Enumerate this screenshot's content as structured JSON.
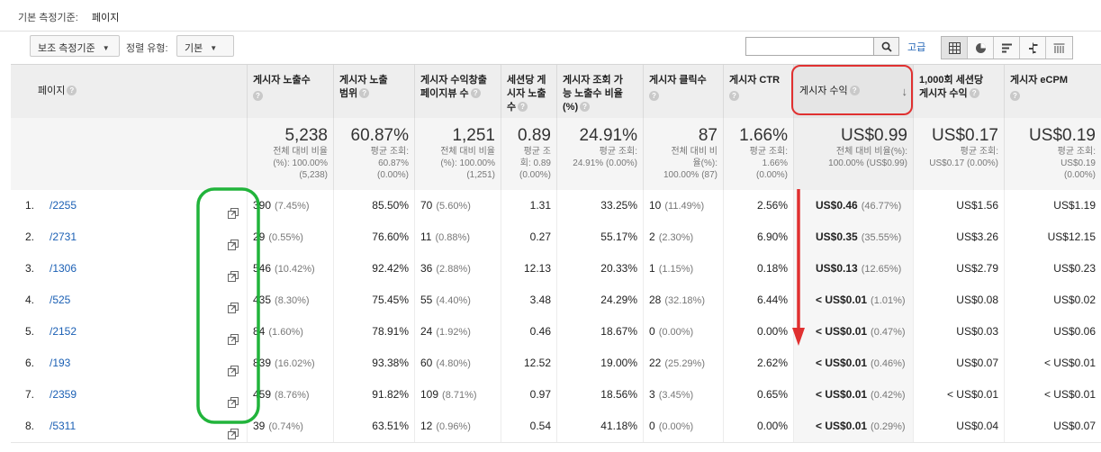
{
  "dimension_bar": {
    "label": "기본 측정기준:",
    "value": "페이지"
  },
  "toolbar": {
    "secondary_dimension": "보조 측정기준",
    "sort_type_label": "정렬 유형:",
    "sort_type_value": "기본",
    "search_placeholder": "",
    "advanced": "고급"
  },
  "columns": [
    "페이지",
    "게시자 노출수",
    "게시자 노출 범위",
    "게시자 수익창출 페이지뷰 수",
    "세션당 게시자 노출 수",
    "게시자 조회 가능 노출수 비율 (%)",
    "게시자 클릭수",
    "게시자 CTR",
    "게시자 수익",
    "1,000회 세션당 게시자 수익",
    "게시자 eCPM"
  ],
  "header_lines": [
    [
      "페이지"
    ],
    [
      "게시자 노출수"
    ],
    [
      "게시자 노출",
      "범위"
    ],
    [
      "게시자 수익창출",
      "페이지뷰 수"
    ],
    [
      "세션당 게",
      "시자 노출",
      "수"
    ],
    [
      "게시자 조회 가",
      "능 노출수 비율",
      "(%)"
    ],
    [
      "게시자 클릭수"
    ],
    [
      "게시자 CTR"
    ],
    [
      "게시자 수익"
    ],
    [
      "1,000회 세션당",
      "게시자 수익"
    ],
    [
      "게시자 eCPM"
    ]
  ],
  "totals": [
    {
      "big": "5,238",
      "sub": [
        "전체 대비 비율",
        "(%): 100.00%",
        "(5,238)"
      ]
    },
    {
      "big": "60.87%",
      "sub": [
        "평균 조회:",
        "60.87%",
        "(0.00%)"
      ]
    },
    {
      "big": "1,251",
      "sub": [
        "전체 대비 비율",
        "(%): 100.00%",
        "(1,251)"
      ]
    },
    {
      "big": "0.89",
      "sub": [
        "평균 조",
        "회: 0.89",
        "(0.00%)"
      ]
    },
    {
      "big": "24.91%",
      "sub": [
        "평균 조회:",
        "24.91% (0.00%)"
      ]
    },
    {
      "big": "87",
      "sub": [
        "전체 대비 비",
        "율(%):",
        "100.00% (87)"
      ]
    },
    {
      "big": "1.66%",
      "sub": [
        "평균 조회:",
        "1.66%",
        "(0.00%)"
      ]
    },
    {
      "big": "US$0.99",
      "sub": [
        "전체 대비 비율(%):",
        "100.00% (US$0.99)"
      ]
    },
    {
      "big": "US$0.17",
      "sub": [
        "평균 조회:",
        "US$0.17 (0.00%)"
      ]
    },
    {
      "big": "US$0.19",
      "sub": [
        "평균 조회:",
        "US$0.19",
        "(0.00%)"
      ]
    }
  ],
  "rows": [
    {
      "n": "1.",
      "page": "/2255",
      "impr": "390",
      "impr_pct": "(7.45%)",
      "cov": "85.50%",
      "pv": "70",
      "pv_pct": "(5.60%)",
      "ips": "1.31",
      "view": "33.25%",
      "clicks": "10",
      "clicks_pct": "(11.49%)",
      "ctr": "2.56%",
      "rev": "US$0.46",
      "rev_pct": "(46.77%)",
      "rps": "US$1.56",
      "ecpm": "US$1.19"
    },
    {
      "n": "2.",
      "page": "/2731",
      "impr": "29",
      "impr_pct": "(0.55%)",
      "cov": "76.60%",
      "pv": "11",
      "pv_pct": "(0.88%)",
      "ips": "0.27",
      "view": "55.17%",
      "clicks": "2",
      "clicks_pct": "(2.30%)",
      "ctr": "6.90%",
      "rev": "US$0.35",
      "rev_pct": "(35.55%)",
      "rps": "US$3.26",
      "ecpm": "US$12.15"
    },
    {
      "n": "3.",
      "page": "/1306",
      "impr": "546",
      "impr_pct": "(10.42%)",
      "cov": "92.42%",
      "pv": "36",
      "pv_pct": "(2.88%)",
      "ips": "12.13",
      "view": "20.33%",
      "clicks": "1",
      "clicks_pct": "(1.15%)",
      "ctr": "0.18%",
      "rev": "US$0.13",
      "rev_pct": "(12.65%)",
      "rps": "US$2.79",
      "ecpm": "US$0.23"
    },
    {
      "n": "4.",
      "page": "/525",
      "impr": "435",
      "impr_pct": "(8.30%)",
      "cov": "75.45%",
      "pv": "55",
      "pv_pct": "(4.40%)",
      "ips": "3.48",
      "view": "24.29%",
      "clicks": "28",
      "clicks_pct": "(32.18%)",
      "ctr": "6.44%",
      "rev": "< US$0.01",
      "rev_pct": "(1.01%)",
      "rps": "US$0.08",
      "ecpm": "US$0.02"
    },
    {
      "n": "5.",
      "page": "/2152",
      "impr": "84",
      "impr_pct": "(1.60%)",
      "cov": "78.91%",
      "pv": "24",
      "pv_pct": "(1.92%)",
      "ips": "0.46",
      "view": "18.67%",
      "clicks": "0",
      "clicks_pct": "(0.00%)",
      "ctr": "0.00%",
      "rev": "< US$0.01",
      "rev_pct": "(0.47%)",
      "rps": "US$0.03",
      "ecpm": "US$0.06"
    },
    {
      "n": "6.",
      "page": "/193",
      "impr": "839",
      "impr_pct": "(16.02%)",
      "cov": "93.38%",
      "pv": "60",
      "pv_pct": "(4.80%)",
      "ips": "12.52",
      "view": "19.00%",
      "clicks": "22",
      "clicks_pct": "(25.29%)",
      "ctr": "2.62%",
      "rev": "< US$0.01",
      "rev_pct": "(0.46%)",
      "rps": "US$0.07",
      "ecpm": "< US$0.01"
    },
    {
      "n": "7.",
      "page": "/2359",
      "impr": "459",
      "impr_pct": "(8.76%)",
      "cov": "91.82%",
      "pv": "109",
      "pv_pct": "(8.71%)",
      "ips": "0.97",
      "view": "18.56%",
      "clicks": "3",
      "clicks_pct": "(3.45%)",
      "ctr": "0.65%",
      "rev": "< US$0.01",
      "rev_pct": "(0.42%)",
      "rps": "< US$0.01",
      "ecpm": "< US$0.01"
    },
    {
      "n": "8.",
      "page": "/5311",
      "impr": "39",
      "impr_pct": "(0.74%)",
      "cov": "63.51%",
      "pv": "12",
      "pv_pct": "(0.96%)",
      "ips": "0.54",
      "view": "41.18%",
      "clicks": "0",
      "clicks_pct": "(0.00%)",
      "ctr": "0.00%",
      "rev": "< US$0.01",
      "rev_pct": "(0.29%)",
      "rps": "US$0.04",
      "ecpm": "US$0.07"
    }
  ],
  "colors": {
    "link": "#1a5fb4",
    "highlight_red": "#e03030",
    "highlight_green": "#21b43b",
    "header_bg": "#eeeeee"
  },
  "icons": [
    "chevron-down-icon",
    "search-icon",
    "table-view-icon",
    "pie-view-icon",
    "bar-view-icon",
    "comparison-view-icon",
    "pivot-view-icon",
    "help-icon",
    "sort-desc-icon",
    "popout-icon"
  ]
}
